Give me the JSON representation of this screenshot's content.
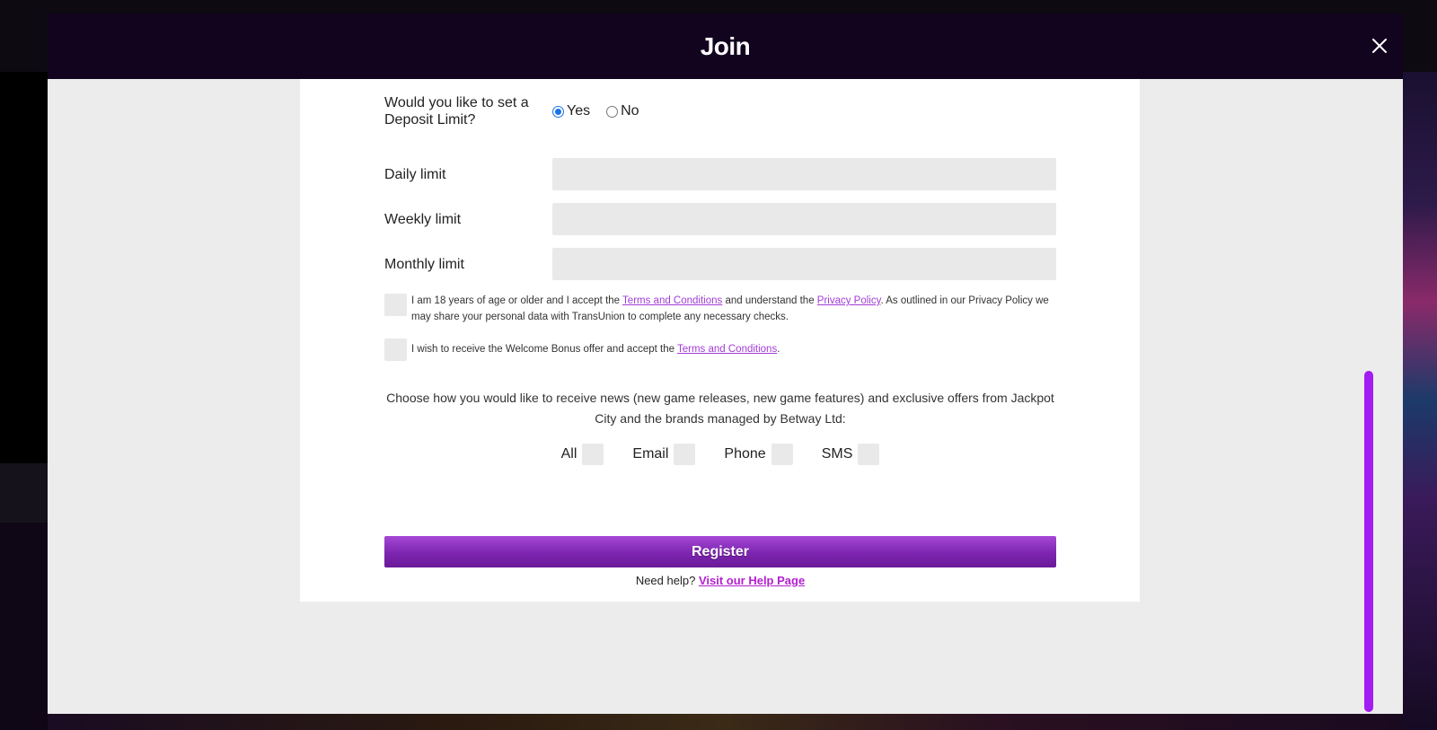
{
  "modal": {
    "title": "Join",
    "close_icon": "close-icon"
  },
  "deposit_limit": {
    "question": "Would you like to set a Deposit Limit?",
    "options": [
      {
        "label": "Yes",
        "selected": true
      },
      {
        "label": "No",
        "selected": false
      }
    ]
  },
  "limits": [
    {
      "label": "Daily limit",
      "value": ""
    },
    {
      "label": "Weekly limit",
      "value": ""
    },
    {
      "label": "Monthly limit",
      "value": ""
    }
  ],
  "consents": {
    "age": {
      "text_1": "I am 18 years of age or older and I accept the ",
      "link_terms": "Terms and Conditions",
      "text_2": " and understand the ",
      "link_privacy": "Privacy Policy",
      "text_3": ". As outlined in our Privacy Policy we may share your personal data with TransUnion to complete any necessary checks.",
      "checked": false
    },
    "bonus": {
      "text_1": "I wish to receive the Welcome Bonus offer and accept the ",
      "link_terms": "Terms and Conditions",
      "text_2": ".",
      "checked": false
    }
  },
  "news": {
    "text": "Choose how you would like to receive news (new game releases, new game features) and exclusive offers from Jackpot City and the brands managed by Betway Ltd:",
    "channels": [
      {
        "label": "All",
        "checked": false
      },
      {
        "label": "Email",
        "checked": false
      },
      {
        "label": "Phone",
        "checked": false
      },
      {
        "label": "SMS",
        "checked": false
      }
    ]
  },
  "register": {
    "label": "Register"
  },
  "help": {
    "prefix": "Need help? ",
    "link": "Visit our Help Page"
  },
  "colors": {
    "header_bg": "#12031f",
    "accent": "#a21cf3",
    "link": "#a23cd6",
    "button_top": "#a548d6",
    "button_bottom": "#6a1a99"
  }
}
